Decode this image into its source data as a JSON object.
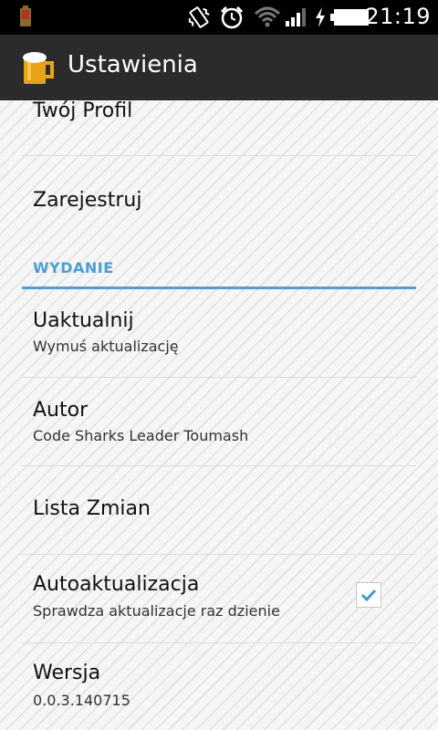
{
  "status_bar": {
    "time": "21:19",
    "icons": [
      "app-notification-icon",
      "vibrate-icon",
      "alarm-icon",
      "wifi-icon",
      "signal-icon",
      "charging-icon",
      "battery-icon"
    ]
  },
  "action_bar": {
    "title": "Ustawienia",
    "icon": "beer-mug-icon"
  },
  "preferences": {
    "profile": {
      "title": "Twój Profil"
    },
    "register": {
      "title": "Zarejestruj"
    },
    "category_release": {
      "title": "WYDANIE"
    },
    "update": {
      "title": "Uaktualnij",
      "summary": "Wymuś aktualizację"
    },
    "author": {
      "title": "Autor",
      "summary": "Code Sharks Leader Toumash"
    },
    "changelog": {
      "title": "Lista Zmian"
    },
    "autoupdate": {
      "title": "Autoaktualizacja",
      "summary": "Sprawdza aktualizacje raz dzienie",
      "checked": true
    },
    "version": {
      "title": "Wersja",
      "summary": "0.0.3.140715"
    }
  },
  "colors": {
    "accent": "#4a9fd5",
    "action_bar": "#2b2b2b",
    "status_bar": "#000000"
  }
}
